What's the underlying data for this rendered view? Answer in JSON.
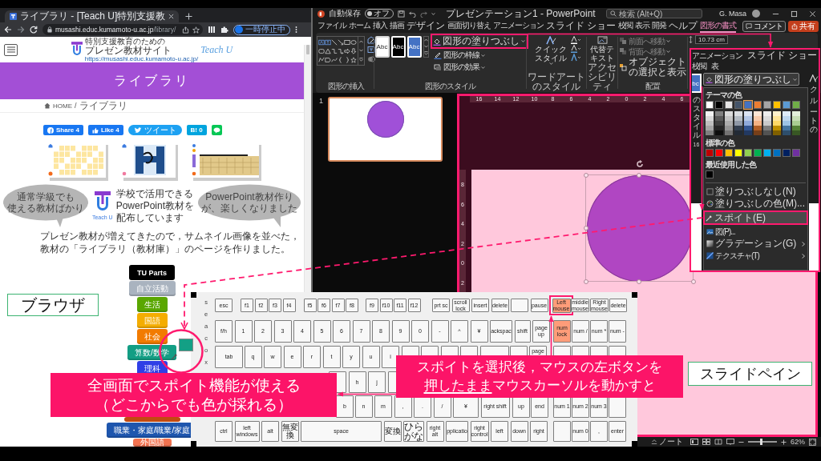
{
  "browser": {
    "tab_title": "ライブラリ - [Teach U]特別支援教",
    "url_host": "musashi.educ.kumamoto-u.ac.jp",
    "url_path": "/library/",
    "profile_status": "一時停止中",
    "logo": {
      "line_1": "特別支援教育のための",
      "line_2": "プレゼン教材サイト",
      "url": "https://musashi.educ.kumamoto-u.ac.jp/",
      "script": "Teach U"
    },
    "page_title": "ライブラリ",
    "breadcrumb": [
      {
        "label": "HOME"
      },
      {
        "label": "ライブラリ"
      }
    ],
    "breadcrumb_separator": "/",
    "share_buttons": [
      {
        "kind": "facebook",
        "label": "Share 4"
      },
      {
        "kind": "like",
        "label": "Like 4"
      },
      {
        "kind": "twitter",
        "label": "ツイート"
      },
      {
        "kind": "hatena",
        "label": "B! 0"
      },
      {
        "kind": "line"
      }
    ],
    "thumbnails": [
      {
        "kind": "letters"
      },
      {
        "kind": "letter_h"
      },
      {
        "kind": "ruler"
      }
    ],
    "banner": {
      "left_bubble": [
        "通常学級でも",
        "使える教材ばかり"
      ],
      "headline": [
        "学校で活用できる",
        "PowerPoint教材を",
        "配布しています"
      ],
      "logo_caption": "Teach U",
      "right_bubble": [
        "PowerPoint教材作り",
        "が、楽しくなりました"
      ]
    },
    "intro": "プレゼン教材が増えてきたので，サムネイル画像を並べた，教材の「ライブラリ（教材庫）」のページを作りました。",
    "categories": [
      {
        "label": "TU Parts",
        "color": "#000000"
      },
      {
        "label": "自立活動",
        "color": "#a9b3bf"
      },
      {
        "label": "生活",
        "color": "#5aa700"
      },
      {
        "label": "国語",
        "color": "#f4ad00"
      },
      {
        "label": "社会",
        "color": "#f27b00"
      },
      {
        "label": "算数/数学",
        "color": "#139e84"
      },
      {
        "label": "理科",
        "color": "#2f3fe6"
      },
      {
        "color": "#c24a10"
      },
      {
        "label": "職業・家庭/職業/家庭",
        "color": "#1e56ae"
      },
      {
        "label": "外国語",
        "color": "#f37350"
      }
    ]
  },
  "powerpoint": {
    "title_bar": {
      "autosave_label": "自動保存",
      "autosave_state": "オフ",
      "autosave_on": false,
      "document_title": "プレゼンテーション1 - PowerPoint",
      "search_placeholder": "検索 (Alt+Q)",
      "user_name": "G. Masa"
    },
    "tabs": [
      {
        "label": "ファイル",
        "selected": false
      },
      {
        "label": "ホーム",
        "selected": false
      },
      {
        "label": "挿入",
        "selected": false
      },
      {
        "label": "描画",
        "selected": false
      },
      {
        "label": "デザイン",
        "selected": false
      },
      {
        "label": "画面切り替え",
        "selected": false
      },
      {
        "label": "アニメーション",
        "selected": false
      },
      {
        "label": "スライド ショー",
        "selected": false
      },
      {
        "label": "校閲",
        "selected": false
      },
      {
        "label": "表示",
        "selected": false
      },
      {
        "label": "開発",
        "selected": false
      },
      {
        "label": "ヘルプ",
        "selected": false
      },
      {
        "label": "図形の書式",
        "selected": true
      }
    ],
    "comment_button": "コメント",
    "share_button": "共有",
    "ribbon": {
      "insert_shapes_label": "図形の挿入",
      "style_presets": [
        {
          "kind": "light",
          "label": "Abc"
        },
        {
          "kind": "dark",
          "label": "Abc"
        },
        {
          "kind": "accent",
          "label": "Abc"
        }
      ],
      "style_buttons": [
        {
          "kind": "fill",
          "label": "図形の塗りつぶし",
          "highlighted": true
        },
        {
          "kind": "outline",
          "label": "図形の枠線",
          "highlighted": false
        },
        {
          "kind": "effects",
          "label": "図形の効果",
          "highlighted": false
        }
      ],
      "shape_styles_label": "図形のスタイル",
      "quick_style": [
        "クイック",
        "スタイル"
      ],
      "wordart_label": "ワードアートのスタイル",
      "alt_text": [
        "代替テ",
        "キスト"
      ],
      "accessibility_label": "アクセシビリティ",
      "arrange_items": [
        {
          "kind": "forward",
          "label": "前面へ移動",
          "disabled": true
        },
        {
          "kind": "backward",
          "label": "背面へ移動",
          "disabled": true
        },
        {
          "kind": "selection",
          "label": "オブジェクトの選択と表示",
          "disabled": false
        }
      ],
      "arrange_label": "配置",
      "shape_width": "10.73 cm"
    },
    "slides": [
      {
        "number": "1",
        "selected": true
      }
    ],
    "ruler_h": [
      "16",
      "14",
      "12",
      "10",
      "8",
      "6",
      "4",
      "2",
      "0",
      "2",
      "4",
      "6"
    ],
    "ruler_v": [
      "8",
      "6",
      "4",
      "2",
      "0",
      "2"
    ],
    "status_bar": {
      "notes": "ノート",
      "zoom": "62%",
      "zoom_slider": {
        "level": 0.45
      }
    }
  },
  "inset": {
    "tabs": [
      "アニメーション",
      "スライド ショー",
      "校閲",
      "表"
    ],
    "preset_fragment": "bc",
    "left_fragment": "のスタイル",
    "ruler_fragment": "16",
    "button": "図形の塗りつぶし",
    "right_fragments": [
      "ク",
      "ル",
      "ートの"
    ],
    "menu": {
      "theme_label": "テーマの色",
      "theme_colors": [
        {
          "color": "#ffffff",
          "selected": false
        },
        {
          "color": "#000000",
          "selected": false
        },
        {
          "color": "#e7e6e6",
          "selected": false
        },
        {
          "color": "#44546a",
          "selected": false
        },
        {
          "color": "#4472c4",
          "selected": true
        },
        {
          "color": "#ed7d31",
          "selected": false
        },
        {
          "color": "#a5a5a5",
          "selected": false
        },
        {
          "color": "#ffc000",
          "selected": false
        },
        {
          "color": "#5b9bd5",
          "selected": false
        },
        {
          "color": "#70ad47",
          "selected": false
        }
      ],
      "standard_label": "標準の色",
      "standard_colors": [
        {
          "color": "#c00000"
        },
        {
          "color": "#ff0000"
        },
        {
          "color": "#ffc000"
        },
        {
          "color": "#ffff00"
        },
        {
          "color": "#92d050"
        },
        {
          "color": "#00b050"
        },
        {
          "color": "#00b0f0"
        },
        {
          "color": "#0070c0"
        },
        {
          "color": "#002060"
        },
        {
          "color": "#7030a0"
        }
      ],
      "recent_label": "最近使用した色",
      "recent_colors": [
        {
          "color": "#000000"
        }
      ],
      "items": [
        {
          "kind": "no_fill",
          "label": "塗りつぶしなし(N)",
          "selected": false,
          "highlighted": false,
          "submenu": false
        },
        {
          "kind": "more_colors",
          "label": "塗りつぶしの色(M)...",
          "selected": false,
          "highlighted": false,
          "submenu": false
        },
        {
          "kind": "eyedropper",
          "label": "スポイト(E)",
          "selected": true,
          "highlighted": true,
          "submenu": false
        },
        {
          "kind": "picture",
          "label": "図(P)...",
          "selected": false,
          "highlighted": false,
          "submenu": false
        },
        {
          "kind": "gradient",
          "label": "グラデーション(G)",
          "selected": false,
          "highlighted": false,
          "submenu": true
        },
        {
          "kind": "texture",
          "label": "テクスチャ(T)",
          "selected": false,
          "highlighted": false,
          "submenu": true
        }
      ]
    }
  },
  "keyboard": {
    "side_letters": [
      "s",
      "e",
      "a",
      "c",
      "o",
      "x"
    ],
    "key_rows": [
      {
        "keys": [
          {
            "label": "esc",
            "lit": false,
            "framed": false
          },
          {
            "label": "f1",
            "lit": false,
            "framed": false
          },
          {
            "label": "f2",
            "lit": false,
            "framed": false
          },
          {
            "label": "f3",
            "lit": false,
            "framed": false
          },
          {
            "label": "f4",
            "lit": false,
            "framed": false
          },
          {
            "label": "f5",
            "lit": false,
            "framed": false
          },
          {
            "label": "f6",
            "lit": false,
            "framed": false
          },
          {
            "label": "f7",
            "lit": false,
            "framed": false
          },
          {
            "label": "f8",
            "lit": false,
            "framed": false
          },
          {
            "label": "f9",
            "lit": false,
            "framed": false
          },
          {
            "label": "f10",
            "lit": false,
            "framed": false
          },
          {
            "label": "f11",
            "lit": false,
            "framed": false
          },
          {
            "label": "f12",
            "lit": false,
            "framed": false
          },
          {
            "label": "prt sc",
            "lit": false,
            "framed": false
          },
          {
            "label": "scroll lock",
            "lit": false,
            "framed": false
          },
          {
            "label": "insert",
            "lit": false,
            "framed": false
          },
          {
            "label": "delete",
            "lit": false,
            "framed": false
          },
          {
            "lit": false,
            "framed": false
          },
          {
            "label": "pause",
            "lit": false,
            "framed": false
          },
          {
            "label": "Left mouse",
            "lit": true,
            "framed": true
          },
          {
            "label": "middle mouse",
            "lit": false,
            "framed": false
          },
          {
            "label": "Right mouse",
            "lit": false,
            "framed": false
          },
          {
            "label": "delete",
            "lit": false,
            "framed": false
          }
        ]
      },
      {
        "keys": [
          {
            "label": "f/h",
            "lit": false,
            "framed": false
          },
          {
            "label": "1",
            "lit": false,
            "framed": false
          },
          {
            "label": "2",
            "lit": false,
            "framed": false
          },
          {
            "label": "3",
            "lit": false,
            "framed": false
          },
          {
            "label": "4",
            "lit": false,
            "framed": false
          },
          {
            "label": "5",
            "lit": false,
            "framed": false
          },
          {
            "label": "6",
            "lit": false,
            "framed": false
          },
          {
            "label": "7",
            "lit": false,
            "framed": false
          },
          {
            "label": "8",
            "lit": false,
            "framed": false
          },
          {
            "label": "9",
            "lit": false,
            "framed": false
          },
          {
            "label": "0",
            "lit": false,
            "framed": false
          },
          {
            "label": "-",
            "lit": false,
            "framed": false
          },
          {
            "label": "^",
            "lit": false,
            "framed": false
          },
          {
            "label": "¥",
            "lit": false,
            "framed": false
          },
          {
            "label": "ackspac",
            "lit": false,
            "framed": false
          },
          {
            "label": "shift",
            "lit": false,
            "framed": false
          },
          {
            "label": "page up",
            "lit": false,
            "framed": false
          },
          {
            "label": "num lock",
            "lit": true,
            "framed": false
          },
          {
            "label": "num /",
            "lit": false,
            "framed": false
          },
          {
            "label": "num *",
            "lit": false,
            "framed": false
          },
          {
            "label": "num -",
            "lit": false,
            "framed": false
          }
        ]
      },
      {
        "keys": [
          {
            "label": "tab",
            "lit": false,
            "framed": false
          },
          {
            "label": "q",
            "lit": false,
            "framed": false
          },
          {
            "label": "w",
            "lit": false,
            "framed": false
          },
          {
            "label": "e",
            "lit": false,
            "framed": false
          },
          {
            "label": "r",
            "lit": false,
            "framed": false
          },
          {
            "label": "t",
            "lit": false,
            "framed": false
          },
          {
            "label": "y",
            "lit": false,
            "framed": false
          },
          {
            "label": "u",
            "lit": false,
            "framed": false
          },
          {
            "label": "i",
            "lit": false,
            "framed": false
          },
          {
            "lit": false,
            "framed": false
          },
          {
            "lit": false,
            "framed": false
          },
          {
            "lit": false,
            "framed": false
          },
          {
            "lit": false,
            "framed": false
          },
          {
            "lit": false,
            "framed": false
          },
          {
            "lit": false,
            "framed": false
          },
          {
            "label": "page",
            "lit": false,
            "framed": false
          },
          {
            "lit": false,
            "framed": false
          },
          {
            "lit": false,
            "framed": false
          },
          {
            "lit": false,
            "framed": false
          },
          {
            "lit": false,
            "framed": false
          }
        ]
      },
      {
        "keys": [
          {
            "lit": false,
            "framed": false
          },
          {
            "label": "h",
            "lit": false,
            "framed": false
          },
          {
            "label": "j",
            "lit": false,
            "framed": false
          },
          {
            "lit": false,
            "framed": false
          }
        ]
      },
      {
        "keys": [
          {
            "label": "b",
            "lit": false,
            "framed": false
          },
          {
            "label": "n",
            "lit": false,
            "framed": false
          },
          {
            "label": "m",
            "lit": false,
            "framed": false
          },
          {
            "label": ",",
            "lit": false,
            "framed": false
          },
          {
            "label": ".",
            "lit": false,
            "framed": false
          },
          {
            "label": "/",
            "lit": false,
            "framed": false
          },
          {
            "label": "¥",
            "lit": false,
            "framed": false
          },
          {
            "label": "right shift",
            "lit": false,
            "framed": false
          },
          {
            "label": "up",
            "lit": false,
            "framed": false
          },
          {
            "label": "end",
            "lit": false,
            "framed": false
          },
          {
            "label": "num 1",
            "lit": false,
            "framed": false
          },
          {
            "label": "num 2",
            "lit": false,
            "framed": false
          },
          {
            "label": "num 3",
            "lit": false,
            "framed": false
          },
          {
            "lit": false,
            "framed": false
          }
        ]
      },
      {
        "keys": [
          {
            "label": "ctrl",
            "lit": false,
            "framed": false
          },
          {
            "label": "left windows",
            "lit": false,
            "framed": false
          },
          {
            "label": "alt",
            "lit": false,
            "framed": false
          },
          {
            "label": "無変換",
            "lit": false,
            "framed": false
          },
          {
            "label": "space",
            "lit": false,
            "framed": false
          },
          {
            "label": "変換",
            "lit": false,
            "framed": false
          },
          {
            "label": "ひらがな",
            "lit": false,
            "framed": false
          },
          {
            "label": "right alt",
            "lit": false,
            "framed": false
          },
          {
            "label": "pplicatio",
            "lit": false,
            "framed": false
          },
          {
            "label": "right control",
            "lit": false,
            "framed": false
          },
          {
            "label": "left",
            "lit": false,
            "framed": false
          },
          {
            "label": "down",
            "lit": false,
            "framed": false
          },
          {
            "label": "right",
            "lit": false,
            "framed": false
          },
          {
            "lit": false,
            "framed": false
          },
          {
            "label": "num 0",
            "lit": false,
            "framed": false
          },
          {
            "label": ",",
            "lit": false,
            "framed": false
          },
          {
            "label": "enter",
            "lit": false,
            "framed": false
          }
        ]
      }
    ]
  },
  "annotations": {
    "browser_label": "ブラウザ",
    "slide_pane_label": "スライドペイン",
    "callout_left": [
      "全画面でスポイト機能が使える",
      "（どこからでも色が採れる）"
    ],
    "callout_right": [
      [
        {
          "text": "スポイトを選択後，マウスの左ボタンを",
          "underline": false
        }
      ],
      [
        {
          "text": "押したまま",
          "underline": true
        },
        {
          "text": "マウスカーソルを動かすと",
          "underline": false
        }
      ]
    ]
  }
}
